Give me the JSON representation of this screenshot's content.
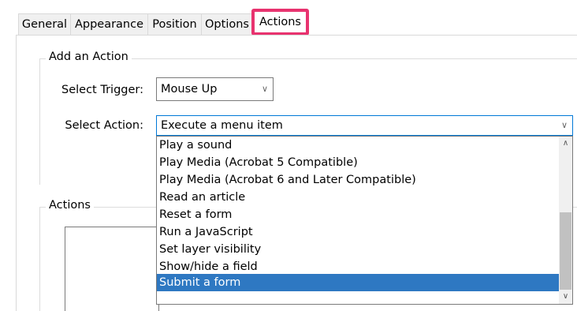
{
  "tabs": [
    {
      "label": "General"
    },
    {
      "label": "Appearance"
    },
    {
      "label": "Position"
    },
    {
      "label": "Options"
    },
    {
      "label": "Actions"
    }
  ],
  "add_action": {
    "legend": "Add an Action",
    "trigger_label": "Select Trigger:",
    "trigger_value": "Mouse Up",
    "action_label": "Select Action:",
    "action_value": "Execute a menu item"
  },
  "actions_group": {
    "legend": "Actions"
  },
  "dropdown": {
    "items": [
      "Play a sound",
      "Play Media (Acrobat 5 Compatible)",
      "Play Media (Acrobat 6 and Later Compatible)",
      "Read an article",
      "Reset a form",
      "Run a JavaScript",
      "Set layer visibility",
      "Show/hide a field",
      "Submit a form"
    ],
    "selected": "Submit a form",
    "selection_color": "#2e78c2"
  },
  "colors": {
    "highlight_border": "#e8336f",
    "focus_border": "#0078d7"
  }
}
